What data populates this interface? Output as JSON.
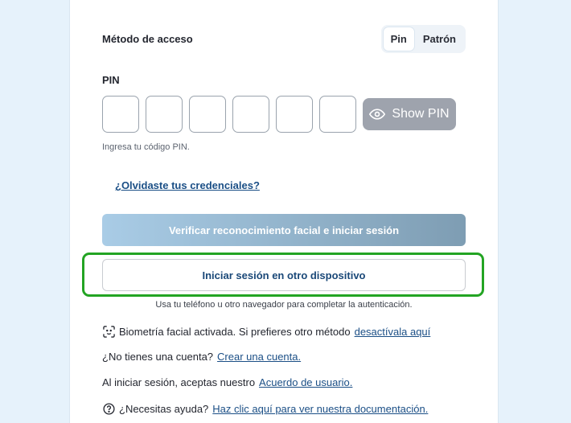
{
  "access_method": {
    "label": "Método de acceso",
    "options": [
      "Pin",
      "Patrón"
    ],
    "selected": "Pin"
  },
  "pin": {
    "label": "PIN",
    "digits": [
      "",
      "",
      "",
      "",
      "",
      ""
    ],
    "show_button": "Show PIN",
    "hint": "Ingresa tu código PIN."
  },
  "forgot_link": "¿Olvidaste tus credenciales?",
  "face_button": "Verificar reconocimiento facial e iniciar sesión",
  "other_device": {
    "button": "Iniciar sesión en otro dispositivo",
    "hint": "Usa tu teléfono u otro navegador para completar la autenticación."
  },
  "biometric": {
    "text": "Biometría facial activada. Si prefieres otro método",
    "link": "desactívala aquí"
  },
  "signup": {
    "text": "¿No tienes una cuenta?",
    "link": "Crear una cuenta."
  },
  "terms": {
    "text": "Al iniciar sesión, aceptas nuestro",
    "link": "Acuerdo de usuario."
  },
  "help": {
    "text": "¿Necesitas ayuda?",
    "link": "Haz clic aquí para ver nuestra documentación."
  },
  "colors": {
    "highlight": "#23a423",
    "link": "#1b4f86",
    "background": "#e6f2fb"
  }
}
